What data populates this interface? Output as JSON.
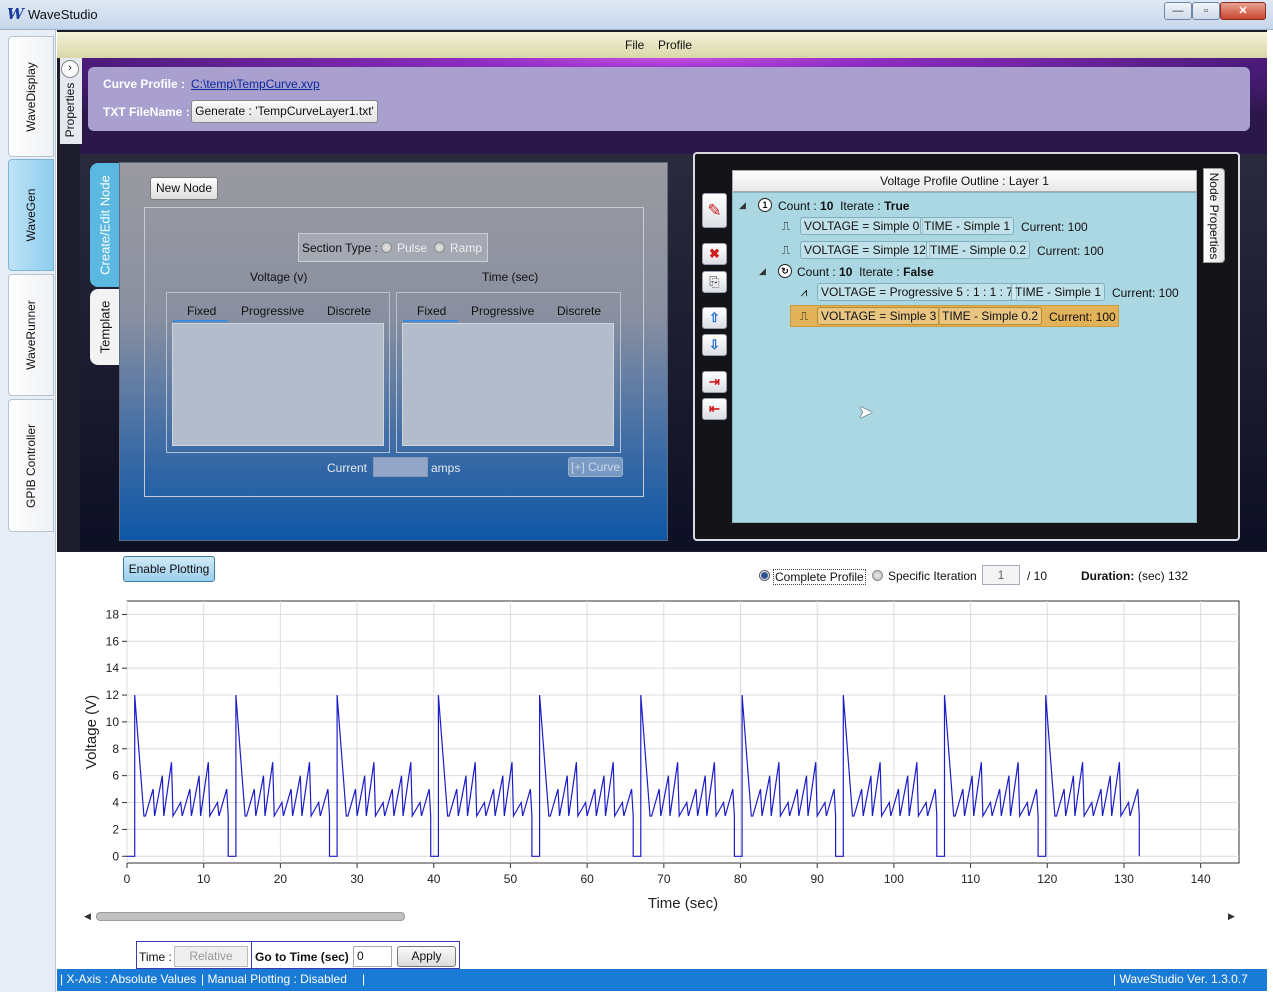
{
  "window": {
    "title": "WaveStudio",
    "logo_glyph": "W",
    "min_glyph": "—",
    "max_glyph": "▫",
    "close_glyph": "✕"
  },
  "left_tabs": [
    {
      "label": "WaveDisplay",
      "active": false
    },
    {
      "label": "WaveGen",
      "active": true
    },
    {
      "label": "WaveRunner",
      "active": false
    },
    {
      "label": "GPIB Controller",
      "active": false
    }
  ],
  "menu": {
    "file": "File",
    "profile": "Profile"
  },
  "properties_panel": {
    "label": "Properties",
    "toggle_glyph": "›"
  },
  "curve": {
    "profile_label": "Curve Profile  :",
    "profile_path": "C:\\temp\\TempCurve.xvp",
    "txt_label": "TXT FileName :",
    "generate_button": "Generate : 'TempCurveLayer1.txt'"
  },
  "node_tabs": {
    "create": "Create/Edit Node",
    "template": "Template"
  },
  "editor": {
    "new_node_button": "New Node",
    "section_type_label": "Section Type :",
    "pulse": "Pulse",
    "ramp": "Ramp",
    "voltage_header": "Voltage (v)",
    "time_header": "Time (sec)",
    "voltage_tabs": [
      "Fixed",
      "Progressive",
      "Discrete"
    ],
    "time_tabs": [
      "Fixed",
      "Progressive",
      "Discrete"
    ],
    "current_label": "Current",
    "current_value": "",
    "amps_label": "amps",
    "add_curve_button": "[+] Curve"
  },
  "outline": {
    "title": "Voltage Profile Outline : Layer 1",
    "node_props_tab": "Node Properties",
    "toolbar": {
      "edit": "✎",
      "delete": "✖",
      "copy": "⎘",
      "up": "⇧",
      "down": "⇩",
      "indent": "⇥",
      "outdent": "⇤"
    },
    "groups": [
      {
        "count_label": "Count :",
        "count": "10",
        "iterate_label": "Iterate :",
        "iterate": "True",
        "icon": "1",
        "rows": [
          {
            "voltage": "VOLTAGE = Simple 0",
            "time": "TIME -  Simple 1",
            "current": "Current: 100"
          },
          {
            "voltage": "VOLTAGE = Simple 12",
            "time": "TIME -  Simple 0.2",
            "current": "Current: 100"
          }
        ]
      },
      {
        "count_label": "Count :",
        "count": "10",
        "iterate_label": "Iterate :",
        "iterate": "False",
        "icon": "↻",
        "rows": [
          {
            "voltage": "VOLTAGE = Progressive 5 : 1 : 1 : 7",
            "time": "TIME -  Simple 1",
            "current": "Current: 100"
          },
          {
            "voltage": "VOLTAGE = Simple 3",
            "time": "TIME -  Simple 0.2",
            "current": "Current: 100",
            "selected": true
          }
        ]
      }
    ]
  },
  "plotting": {
    "enable_button": "Enable Plotting",
    "complete_profile": "Complete Profile",
    "specific_iteration": "Specific Iteration",
    "iteration_value": "1",
    "iteration_total": "/ 10",
    "duration_label": "Duration:",
    "duration_unit": "(sec)",
    "duration_value": "132"
  },
  "chart_data": {
    "type": "line",
    "xlabel": "Time (sec)",
    "ylabel": "Voltage (V)",
    "xlim": [
      0,
      145
    ],
    "ylim": [
      -0.5,
      19
    ],
    "xticks": [
      0,
      10,
      20,
      30,
      40,
      50,
      60,
      70,
      80,
      90,
      100,
      110,
      120,
      130,
      140
    ],
    "yticks": [
      0,
      2,
      4,
      6,
      8,
      10,
      12,
      14,
      16,
      18
    ],
    "grid": true,
    "line_color": "#1c1cc8",
    "description_model": "10 outer iterations of 13.2 s: 0 V for 1 s, 12 V spike decaying, then 10 sawtooth cycles ramping 3 V to 4..7 V, with 0 V dips",
    "outer_iterations": 10,
    "period_sec": 13.2,
    "segments": {
      "zero_hold": {
        "voltage": 0,
        "duration": 1
      },
      "spike": {
        "voltage": 12,
        "duration": 0.2
      },
      "ramp_peaks": [
        4,
        5,
        6,
        7
      ],
      "ramp_base": 3,
      "inner_cycles": 10,
      "ramp_duration": 1,
      "drop_duration": 0.2
    }
  },
  "scroll": {
    "left": "◀",
    "right": "▶"
  },
  "time_controls": {
    "time_label": "Time :",
    "relative_button": "Relative",
    "goto_label": "Go to Time (sec)",
    "goto_value": "0",
    "apply_button": "Apply"
  },
  "status": {
    "xaxis": "|  X-Axis : Absolute Values",
    "manual": "|  Manual Plotting : Disabled",
    "sep": "|",
    "version": "|  WaveStudio Ver.  1.3.0.7"
  },
  "colors": {
    "status_bar": "#1a7bd6",
    "selected_row": "#e2b259",
    "tree_bg": "#abd7e2",
    "accent_tab": "#5ab8e1"
  }
}
